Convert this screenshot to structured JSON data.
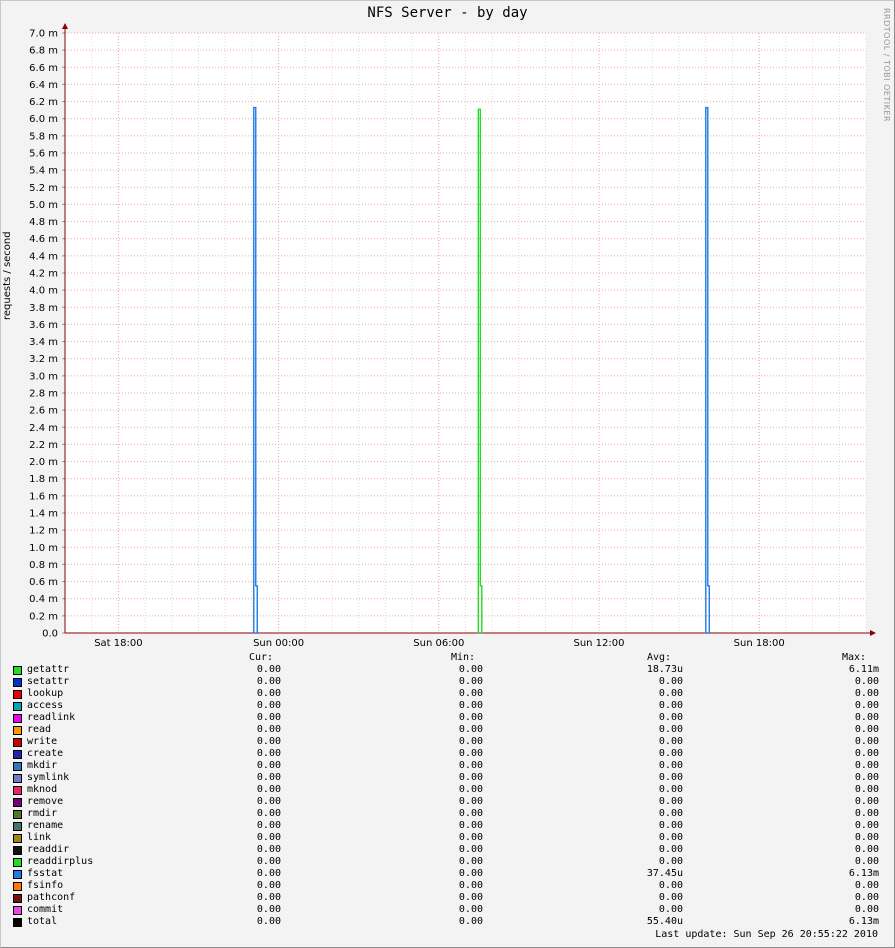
{
  "title": "NFS Server - by day",
  "watermark": "RRDTOOL / TOBI OETIKER",
  "chart_data": {
    "type": "line",
    "title": "NFS Server - by day",
    "ylabel": "requests / second",
    "ylim": [
      0,
      7.0
    ],
    "y_unit": "m",
    "yticks": [
      "0.0",
      "0.2 m",
      "0.4 m",
      "0.6 m",
      "0.8 m",
      "1.0 m",
      "1.2 m",
      "1.4 m",
      "1.6 m",
      "1.8 m",
      "2.0 m",
      "2.2 m",
      "2.4 m",
      "2.6 m",
      "2.8 m",
      "3.0 m",
      "3.2 m",
      "3.4 m",
      "3.6 m",
      "3.8 m",
      "4.0 m",
      "4.2 m",
      "4.4 m",
      "4.6 m",
      "4.8 m",
      "5.0 m",
      "5.2 m",
      "5.4 m",
      "5.6 m",
      "5.8 m",
      "6.0 m",
      "6.2 m",
      "6.4 m",
      "6.6 m",
      "6.8 m",
      "7.0 m"
    ],
    "xrange_hours": [
      0,
      30
    ],
    "xticks": [
      {
        "label": "Sat 18:00",
        "hour": 2
      },
      {
        "label": "Sun 00:00",
        "hour": 8
      },
      {
        "label": "Sun 06:00",
        "hour": 14
      },
      {
        "label": "Sun 12:00",
        "hour": 20
      },
      {
        "label": "Sun 18:00",
        "hour": 26
      }
    ],
    "grid": true,
    "series": [
      {
        "name": "fsstat",
        "color": "#1e7ce6",
        "spikes": [
          {
            "start_hour": 7.07,
            "end_hour": 7.2,
            "peak": 6.13,
            "tail": 0.55
          },
          {
            "start_hour": 24.0,
            "end_hour": 24.13,
            "peak": 6.13,
            "tail": 0.55
          }
        ]
      },
      {
        "name": "getattr",
        "color": "#22dd22",
        "spikes": [
          {
            "start_hour": 15.48,
            "end_hour": 15.61,
            "peak": 6.11,
            "tail": 0.55
          }
        ]
      }
    ]
  },
  "legend": {
    "headers": {
      "cur": "Cur:",
      "min": "Min:",
      "avg": "Avg:",
      "max": "Max:"
    },
    "rows": [
      {
        "name": "getattr",
        "color": "#22dd22",
        "cur": "0.00",
        "min": "0.00",
        "avg": "18.73u",
        "max": "6.11m"
      },
      {
        "name": "setattr",
        "color": "#0033cc",
        "cur": "0.00",
        "min": "0.00",
        "avg": "0.00",
        "max": "0.00"
      },
      {
        "name": "lookup",
        "color": "#ee0000",
        "cur": "0.00",
        "min": "0.00",
        "avg": "0.00",
        "max": "0.00"
      },
      {
        "name": "access",
        "color": "#00aaaa",
        "cur": "0.00",
        "min": "0.00",
        "avg": "0.00",
        "max": "0.00"
      },
      {
        "name": "readlink",
        "color": "#ee00ee",
        "cur": "0.00",
        "min": "0.00",
        "avg": "0.00",
        "max": "0.00"
      },
      {
        "name": "read",
        "color": "#ff9900",
        "cur": "0.00",
        "min": "0.00",
        "avg": "0.00",
        "max": "0.00"
      },
      {
        "name": "write",
        "color": "#cc0000",
        "cur": "0.00",
        "min": "0.00",
        "avg": "0.00",
        "max": "0.00"
      },
      {
        "name": "create",
        "color": "#2222aa",
        "cur": "0.00",
        "min": "0.00",
        "avg": "0.00",
        "max": "0.00"
      },
      {
        "name": "mkdir",
        "color": "#3377bb",
        "cur": "0.00",
        "min": "0.00",
        "avg": "0.00",
        "max": "0.00"
      },
      {
        "name": "symlink",
        "color": "#7777cc",
        "cur": "0.00",
        "min": "0.00",
        "avg": "0.00",
        "max": "0.00"
      },
      {
        "name": "mknod",
        "color": "#ee2266",
        "cur": "0.00",
        "min": "0.00",
        "avg": "0.00",
        "max": "0.00"
      },
      {
        "name": "remove",
        "color": "#770077",
        "cur": "0.00",
        "min": "0.00",
        "avg": "0.00",
        "max": "0.00"
      },
      {
        "name": "rmdir",
        "color": "#557722",
        "cur": "0.00",
        "min": "0.00",
        "avg": "0.00",
        "max": "0.00"
      },
      {
        "name": "rename",
        "color": "#447766",
        "cur": "0.00",
        "min": "0.00",
        "avg": "0.00",
        "max": "0.00"
      },
      {
        "name": "link",
        "color": "#998811",
        "cur": "0.00",
        "min": "0.00",
        "avg": "0.00",
        "max": "0.00"
      },
      {
        "name": "readdir",
        "color": "#111111",
        "cur": "0.00",
        "min": "0.00",
        "avg": "0.00",
        "max": "0.00"
      },
      {
        "name": "readdirplus",
        "color": "#22dd22",
        "cur": "0.00",
        "min": "0.00",
        "avg": "0.00",
        "max": "0.00"
      },
      {
        "name": "fsstat",
        "color": "#1e7ce6",
        "cur": "0.00",
        "min": "0.00",
        "avg": "37.45u",
        "max": "6.13m"
      },
      {
        "name": "fsinfo",
        "color": "#ff7700",
        "cur": "0.00",
        "min": "0.00",
        "avg": "0.00",
        "max": "0.00"
      },
      {
        "name": "pathconf",
        "color": "#771111",
        "cur": "0.00",
        "min": "0.00",
        "avg": "0.00",
        "max": "0.00"
      },
      {
        "name": "commit",
        "color": "#ee44ee",
        "cur": "0.00",
        "min": "0.00",
        "avg": "0.00",
        "max": "0.00"
      },
      {
        "name": "total",
        "color": "#000000",
        "cur": "0.00",
        "min": "0.00",
        "avg": "55.40u",
        "max": "6.13m"
      }
    ]
  },
  "last_update": "Last update:  Sun Sep 26 20:55:22 2010"
}
